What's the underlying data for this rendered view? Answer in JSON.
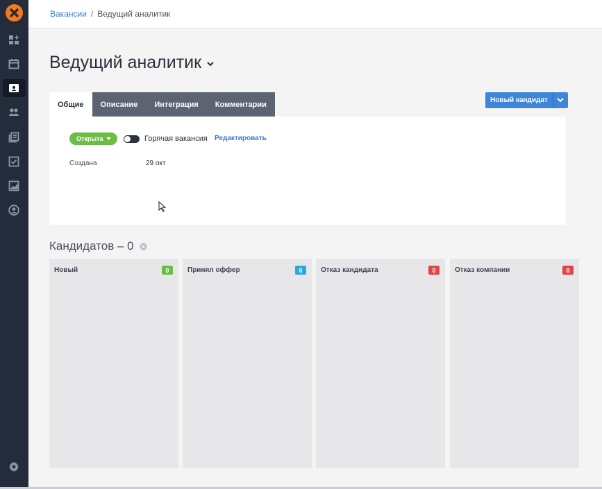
{
  "sidebar": {
    "logo_icon": "orange-x-logo",
    "items": [
      {
        "name": "dashboard",
        "icon": "dashboard-icon"
      },
      {
        "name": "calendar",
        "icon": "calendar-icon"
      },
      {
        "name": "vacancies",
        "icon": "vacancy-folder-icon",
        "active": true
      },
      {
        "name": "candidates",
        "icon": "people-icon"
      },
      {
        "name": "library",
        "icon": "library-icon"
      },
      {
        "name": "tasks",
        "icon": "tasks-check-icon"
      },
      {
        "name": "reports",
        "icon": "chart-icon"
      },
      {
        "name": "profile",
        "icon": "user-circle-icon"
      }
    ],
    "settings_icon": "gear-icon"
  },
  "breadcrumb": {
    "link": "Вакансии",
    "separator": "/",
    "current": "Ведущий аналитик"
  },
  "page": {
    "title": "Ведущий аналитик"
  },
  "tabs": [
    {
      "label": "Общие",
      "active": true
    },
    {
      "label": "Описание"
    },
    {
      "label": "Интеграция"
    },
    {
      "label": "Комментарии"
    }
  ],
  "actions": {
    "new_candidate_label": "Новый кандидат"
  },
  "card": {
    "status_label": "Открыта",
    "hot_toggle_label": "Горячая вакансия",
    "hot_toggle_on": false,
    "edit_label": "Редактировать",
    "created_label": "Создана",
    "created_value": "29 окт"
  },
  "candidates": {
    "title": "Кандидатов – 0",
    "columns": [
      {
        "title": "Новый",
        "count": "0",
        "color": "#6bbd45"
      },
      {
        "title": "Принял оффер",
        "count": "0",
        "color": "#2aa8e0"
      },
      {
        "title": "Отказ кандидата",
        "count": "0",
        "color": "#e0454b"
      },
      {
        "title": "Отказ компании",
        "count": "0",
        "color": "#e0454b"
      }
    ]
  },
  "colors": {
    "sidebar_bg": "#242b3a",
    "accent_blue": "#3d86d8",
    "status_green": "#6bbd45",
    "logo_orange": "#f47a20"
  }
}
